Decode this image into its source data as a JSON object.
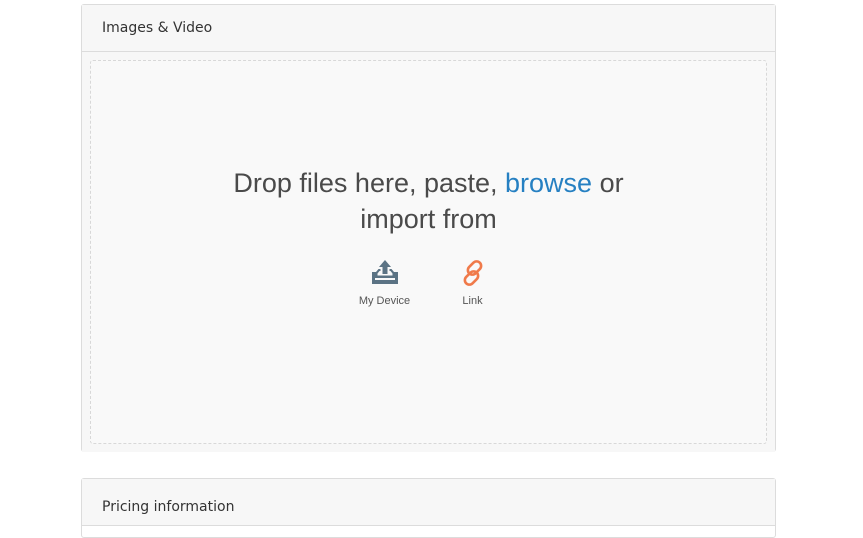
{
  "media": {
    "title": "Images & Video",
    "drop": {
      "line1_prefix": "Drop files here, paste, ",
      "browse": "browse",
      "line1_suffix": " or",
      "line2": "import from"
    },
    "sources": [
      {
        "label": "My Device",
        "icon": "upload-tray-icon",
        "color": "#5b7384"
      },
      {
        "label": "Link",
        "icon": "link-icon",
        "color": "#f07a4a"
      }
    ],
    "accent_color": "#2680c2"
  },
  "pricing": {
    "title": "Pricing information"
  }
}
